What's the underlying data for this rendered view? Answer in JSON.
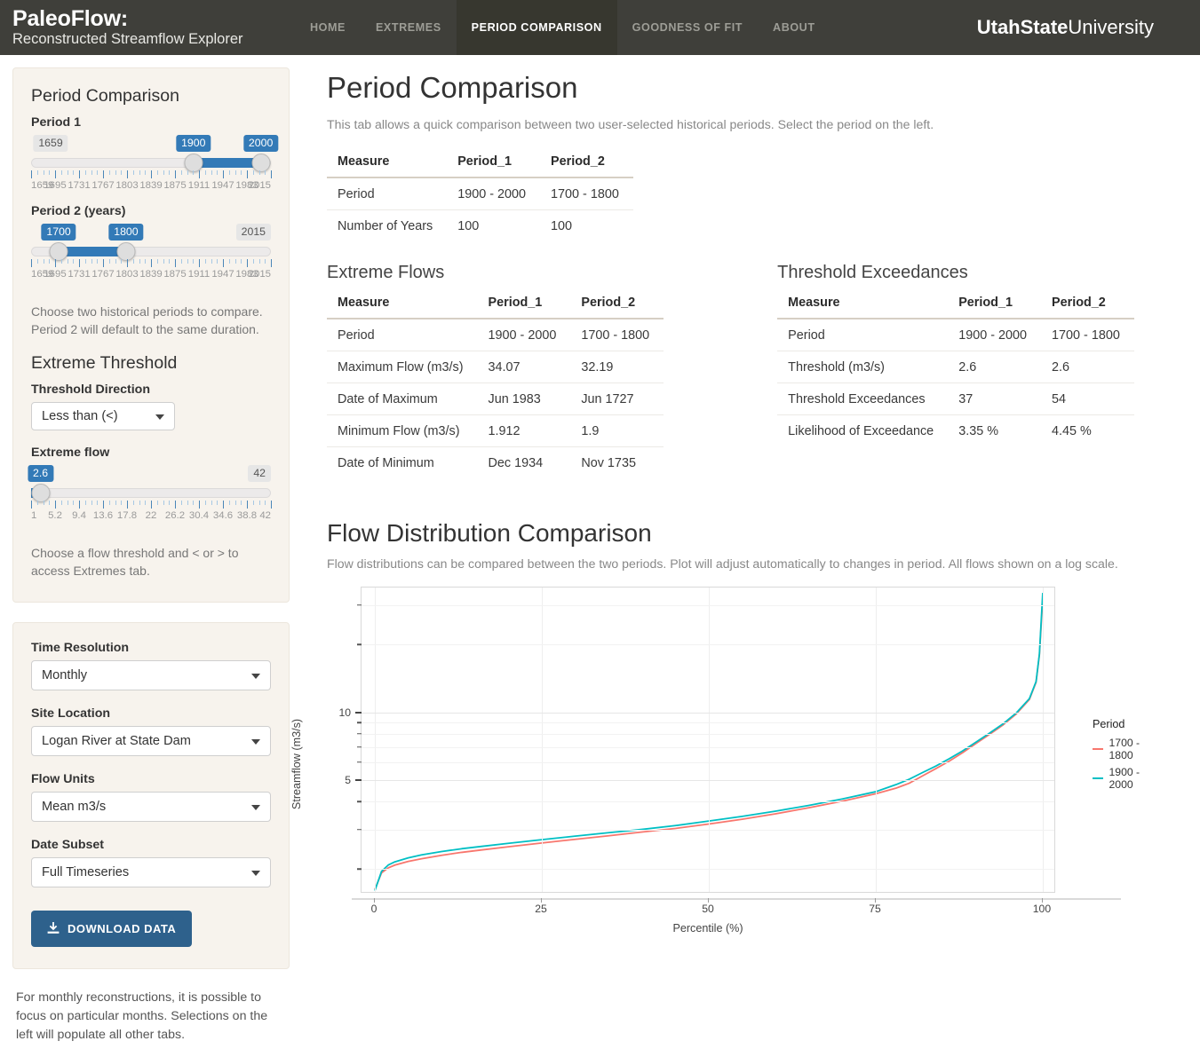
{
  "navbar": {
    "brand_line1": "PaleoFlow:",
    "brand_line2": "Reconstructed Streamflow Explorer",
    "links": [
      {
        "label": "HOME",
        "active": false
      },
      {
        "label": "EXTREMES",
        "active": false
      },
      {
        "label": "PERIOD COMPARISON",
        "active": true
      },
      {
        "label": "GOODNESS OF FIT",
        "active": false
      },
      {
        "label": "ABOUT",
        "active": false
      }
    ],
    "org_bold": "UtahState",
    "org_light": "University"
  },
  "sidebar": {
    "panel1_title": "Period Comparison",
    "period1": {
      "label": "Period 1",
      "min_badge": "1659",
      "max_badge": "",
      "low_value": "1900",
      "high_value": "2000",
      "axis_min": 1659,
      "axis_max": 2015,
      "tick_labels": [
        "1659",
        "1695",
        "1731",
        "1767",
        "1803",
        "1839",
        "1875",
        "1911",
        "1947",
        "1983",
        "2015"
      ]
    },
    "period2": {
      "label": "Period 2 (years)",
      "min_badge": "",
      "max_badge": "2015",
      "low_value": "1700",
      "high_value": "1800",
      "axis_min": 1659,
      "axis_max": 2015,
      "tick_labels": [
        "1659",
        "1695",
        "1731",
        "1767",
        "1803",
        "1839",
        "1875",
        "1911",
        "1947",
        "1983",
        "2015"
      ]
    },
    "period_help": "Choose two historical periods to compare. Period 2 will default to the same duration.",
    "threshold_title": "Extreme Threshold",
    "threshold_direction_label": "Threshold Direction",
    "threshold_direction_value": "Less than (<)",
    "extreme_flow_label": "Extreme flow",
    "extreme_flow": {
      "value": "2.6",
      "max_badge": "42",
      "axis_min": 1,
      "axis_max": 42,
      "tick_labels": [
        "1",
        "5.2",
        "9.4",
        "13.6",
        "17.8",
        "22",
        "26.2",
        "30.4",
        "34.6",
        "38.8",
        "42"
      ]
    },
    "threshold_help": "Choose a flow threshold and < or > to access Extremes tab.",
    "time_resolution_label": "Time Resolution",
    "time_resolution_value": "Monthly",
    "site_location_label": "Site Location",
    "site_location_value": "Logan River at State Dam",
    "flow_units_label": "Flow Units",
    "flow_units_value": "Mean m3/s",
    "date_subset_label": "Date Subset",
    "date_subset_value": "Full Timeseries",
    "download_label": "DOWNLOAD DATA",
    "footnote": "For monthly reconstructions, it is possible to focus on particular months. Selections on the left will populate all other tabs."
  },
  "main": {
    "page_title": "Period Comparison",
    "page_subtitle": "This tab allows a quick comparison between two user-selected historical periods. Select the period on the left.",
    "summary_table": {
      "headers": [
        "Measure",
        "Period_1",
        "Period_2"
      ],
      "rows": [
        [
          "Period",
          "1900 - 2000",
          "1700 - 1800"
        ],
        [
          "Number of Years",
          "100",
          "100"
        ]
      ]
    },
    "extreme_flows": {
      "title": "Extreme Flows",
      "headers": [
        "Measure",
        "Period_1",
        "Period_2"
      ],
      "rows": [
        [
          "Period",
          "1900 - 2000",
          "1700 - 1800"
        ],
        [
          "Maximum Flow (m3/s)",
          "34.07",
          "32.19"
        ],
        [
          "Date of Maximum",
          "Jun 1983",
          "Jun 1727"
        ],
        [
          "Minimum Flow (m3/s)",
          "1.912",
          "1.9"
        ],
        [
          "Date of Minimum",
          "Dec 1934",
          "Nov 1735"
        ]
      ]
    },
    "threshold_exceedances": {
      "title": "Threshold Exceedances",
      "headers": [
        "Measure",
        "Period_1",
        "Period_2"
      ],
      "rows": [
        [
          "Period",
          "1900 - 2000",
          "1700 - 1800"
        ],
        [
          "Threshold (m3/s)",
          "2.6",
          "2.6"
        ],
        [
          "Threshold Exceedances",
          "37",
          "54"
        ],
        [
          "Likelihood of Exceedance",
          "3.35 %",
          "4.45 %"
        ]
      ]
    },
    "chart_section_title": "Flow Distribution Comparison",
    "chart_section_subtitle": "Flow distributions can be compared between the two periods. Plot will adjust automatically to changes in period. All flows shown on a log scale."
  },
  "chart_data": {
    "type": "line",
    "title": "Flow Distribution Comparison",
    "xlabel": "Percentile (%)",
    "ylabel": "Streamflow (m3/s)",
    "xlim": [
      -2,
      102
    ],
    "xticks": [
      0,
      25,
      50,
      75,
      100
    ],
    "yscale": "log",
    "ylim": [
      1.55,
      36
    ],
    "yticks_major": [
      5,
      10
    ],
    "yticks_minor": [
      2,
      3,
      4,
      6,
      7,
      8,
      9,
      20,
      30
    ],
    "grid": true,
    "legend_title": "Period",
    "legend_position": "right",
    "colors": {
      "period_1700_1800": "#F8766D",
      "period_1900_2000": "#00BFC4"
    },
    "x": [
      0,
      1,
      2,
      3,
      5,
      7,
      10,
      13,
      16,
      20,
      25,
      30,
      35,
      40,
      45,
      50,
      55,
      60,
      65,
      70,
      75,
      78,
      80,
      82,
      84,
      86,
      88,
      90,
      92,
      94,
      96,
      98,
      99,
      99.5,
      100
    ],
    "series": [
      {
        "name": "1700 - 1800",
        "color": "#F8766D",
        "values": [
          1.62,
          1.92,
          2.02,
          2.08,
          2.16,
          2.22,
          2.3,
          2.37,
          2.43,
          2.51,
          2.61,
          2.71,
          2.81,
          2.92,
          3.03,
          3.17,
          3.33,
          3.52,
          3.75,
          4.01,
          4.33,
          4.58,
          4.82,
          5.2,
          5.6,
          6.05,
          6.6,
          7.25,
          7.95,
          8.75,
          9.8,
          11.4,
          13.6,
          18.0,
          32.19
        ]
      },
      {
        "name": "1900 - 2000",
        "color": "#00BFC4",
        "values": [
          1.6,
          1.95,
          2.08,
          2.15,
          2.24,
          2.31,
          2.39,
          2.46,
          2.52,
          2.6,
          2.7,
          2.8,
          2.9,
          3.0,
          3.12,
          3.27,
          3.43,
          3.62,
          3.84,
          4.1,
          4.42,
          4.75,
          5.02,
          5.38,
          5.75,
          6.2,
          6.72,
          7.35,
          8.05,
          8.85,
          9.9,
          11.5,
          13.7,
          18.2,
          34.07
        ]
      }
    ]
  }
}
